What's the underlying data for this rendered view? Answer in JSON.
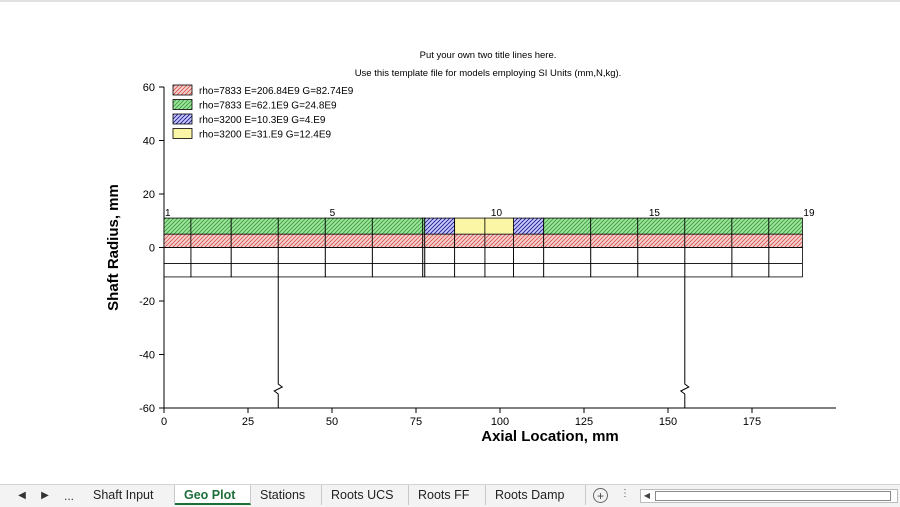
{
  "chart": {
    "title_line_1": "Put your own two title lines here.",
    "title_line_2": "Use this template file for models employing SI Units (mm,N,kg).",
    "xlabel": "Axial Location, mm",
    "ylabel": "Shaft Radius, mm"
  },
  "chart_data": {
    "type": "other",
    "title": "Put your own two title lines here. / Use this template file for models employing SI Units (mm,N,kg).",
    "xlabel": "Axial Location, mm",
    "ylabel": "Shaft Radius, mm",
    "xlim": [
      0,
      200
    ],
    "ylim": [
      -60,
      60
    ],
    "x_ticks": [
      0,
      25,
      50,
      75,
      100,
      125,
      150,
      175
    ],
    "y_ticks": [
      60,
      40,
      20,
      0,
      -20,
      -40,
      -60
    ],
    "legend": [
      {
        "label": "rho=7833  E=206.84E9  G=82.74E9",
        "color": "#d9534f",
        "hatch": "diag",
        "fill": "#f3d3d0"
      },
      {
        "label": "rho=7833  E=62.1E9  G=24.8E9",
        "color": "#3a9a3a",
        "hatch": "diag",
        "fill": "#9fe59f"
      },
      {
        "label": "rho=3200  E=10.3E9  G=4.E9",
        "color": "#1a1a8a",
        "hatch": "diag",
        "fill": "#c9c9ff"
      },
      {
        "label": "rho=3200  E=31.E9  G=12.4E9",
        "color": "#e3d36a",
        "hatch": "none",
        "fill": "#fbf6a6"
      }
    ],
    "station_labels": [
      {
        "x": 0,
        "label": "1"
      },
      {
        "x": 49,
        "label": "5"
      },
      {
        "x": 97,
        "label": "10"
      },
      {
        "x": 144,
        "label": "15"
      },
      {
        "x": 190,
        "label": "19"
      }
    ],
    "stations": [
      0,
      8,
      20,
      34,
      48,
      62,
      77,
      77.6,
      86.5,
      95.5,
      104,
      113,
      127,
      141,
      155,
      169,
      180,
      190
    ],
    "inner_layer": {
      "material": 0,
      "r_in": 0,
      "r_out": 5
    },
    "outer_layer_materials": [
      1,
      1,
      1,
      1,
      1,
      1,
      1,
      2,
      3,
      3,
      2,
      1,
      1,
      1,
      1,
      1,
      1
    ],
    "outer_layer": {
      "r_in": 5,
      "r_out": 11
    },
    "mirror_outline": {
      "default": [
        -6,
        -11
      ],
      "by_segment": {
        "7": [
          -6,
          -11
        ],
        "10": [
          -6,
          -11
        ]
      }
    },
    "supports": [
      {
        "x": 34,
        "y_top": -11,
        "y_bottom": -60
      },
      {
        "x": 155,
        "y_top": -11,
        "y_bottom": -60
      }
    ]
  },
  "tabs": {
    "nav_prev": "◀",
    "nav_next": "▶",
    "nav_more": "...",
    "items": [
      "Shaft Input",
      "Geo Plot",
      "Stations",
      "Roots UCS",
      "Roots FF",
      "Roots Damp"
    ],
    "active": "Geo Plot",
    "add": "+",
    "options": "⋮",
    "scroll_left": "◀"
  }
}
